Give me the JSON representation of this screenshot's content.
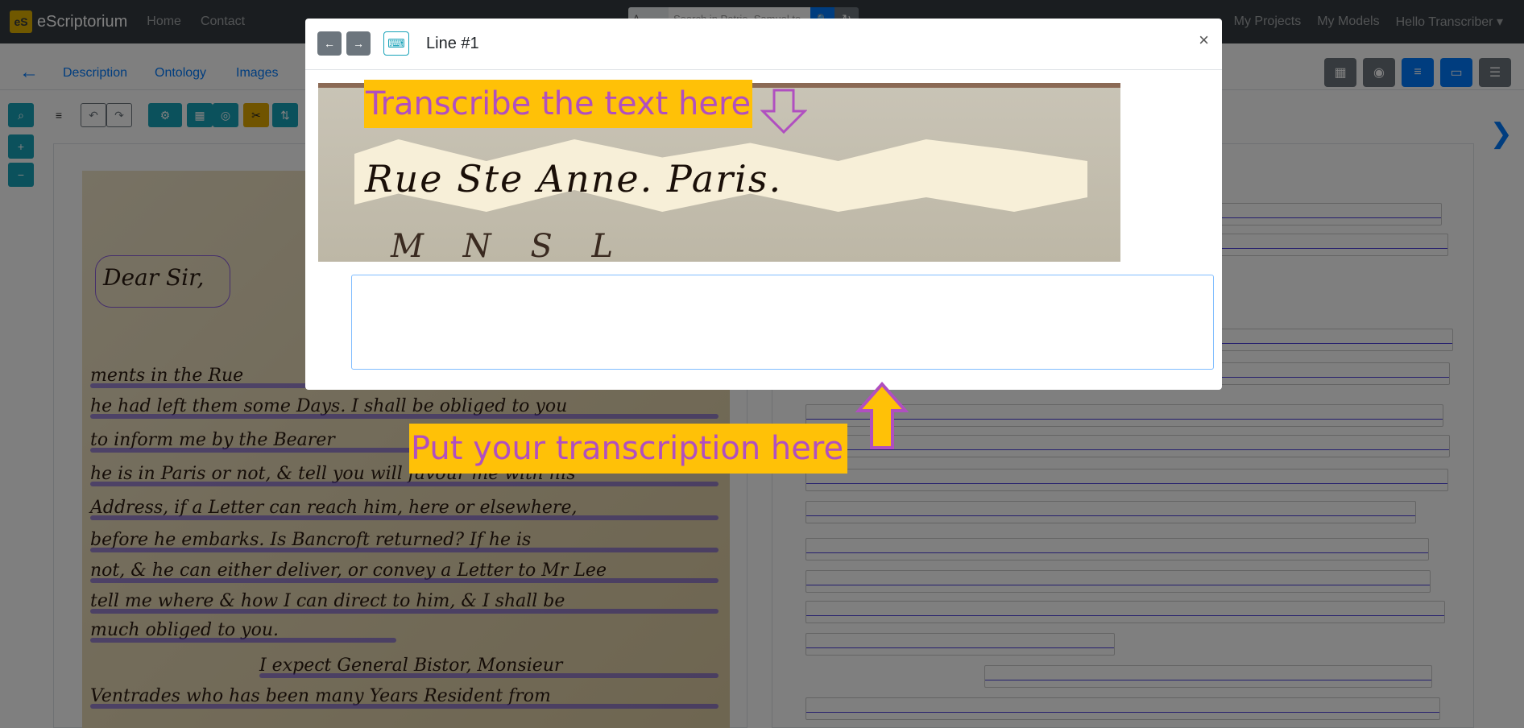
{
  "navbar": {
    "brand_logo": "eS",
    "brand": "eScriptorium",
    "links": [
      "Home",
      "Contact"
    ],
    "search_select": "A",
    "search_placeholder": "Search in Patrie, Samuel to",
    "right_links": [
      "My Projects",
      "My Models",
      "Hello Transcriber"
    ]
  },
  "subbar": {
    "tabs": [
      "Description",
      "Ontology",
      "Images"
    ]
  },
  "icons": {
    "back": "←",
    "next_panel": "❯",
    "search": "🔍",
    "refresh": "↻",
    "prev": "←",
    "next": "→",
    "keyboard": "⌨",
    "close": "×",
    "caret": "▾"
  },
  "handwriting": {
    "salutation": "Dear Sir,",
    "lines": [
      "ments in the Rue",
      "he had left them some Days. I shall be obliged to you",
      "to inform me by the Bearer",
      "he is in Paris or not, & tell you will favour me with his",
      "Address, if a Letter can reach him, here or elsewhere,",
      "before he embarks. Is Bancroft returned? If he is",
      "not, & he can either deliver, or convey a Letter to Mr Lee",
      "tell me where & how I can direct to him, & I shall be",
      "much obliged to you.",
      "I expect General Bistor, Monsieur",
      "Ventrades who has been many Years Resident from"
    ]
  },
  "modal": {
    "title": "Line #1",
    "line_image_text": "Rue Ste Anne. Paris.",
    "line_image_below": "M N S L",
    "input_value": ""
  },
  "callouts": {
    "top": "Transcribe the text here",
    "bottom": "Put your transcription here"
  },
  "colors": {
    "navbar": "#343a40",
    "primary": "#007bff",
    "info": "#17a2b8",
    "warning": "#ffc107",
    "callout_text": "#b04fc0",
    "line_mask": "#4a3fdc"
  }
}
